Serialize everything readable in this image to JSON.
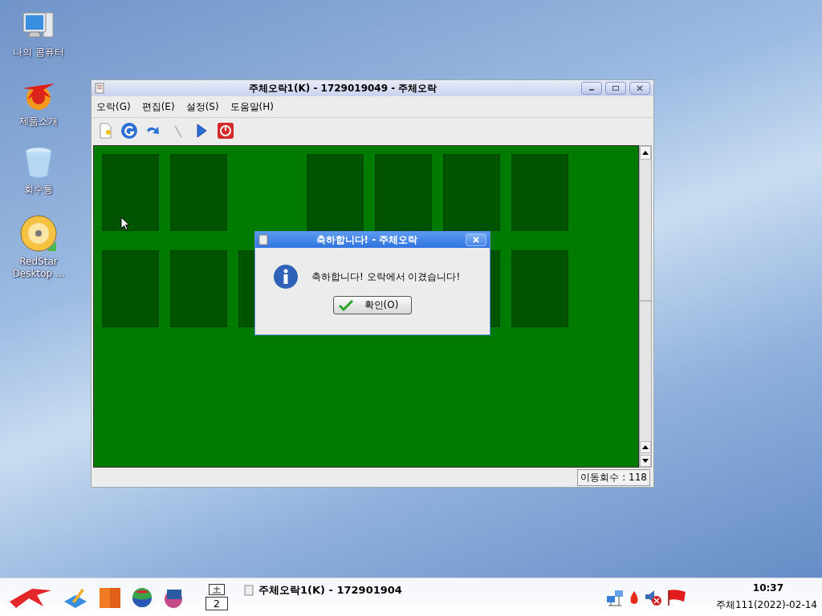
{
  "desktop_icons": [
    {
      "label": "나의 콤퓨터",
      "kind": "computer"
    },
    {
      "label": "제품소개",
      "kind": "star"
    },
    {
      "label": "회수통",
      "kind": "trash"
    },
    {
      "label": "RedStar Desktop ...",
      "kind": "disc"
    }
  ],
  "window": {
    "title": "주체오락1(K) - 1729019049 - 주체오락",
    "menu": [
      "오락(G)",
      "편집(E)",
      "설정(S)",
      "도움말(H)"
    ],
    "status": "이동회수 : 118"
  },
  "dialog": {
    "title": "축하합니다! - 주체오락",
    "message": "축하합니다! 오락에서 이겼습니다!",
    "button": "확인(O)"
  },
  "taskbar": {
    "pager": "2",
    "task": "주체오락1(K) - 172901904",
    "clock": "10:37",
    "date": "주체111(2022)-02-14"
  }
}
